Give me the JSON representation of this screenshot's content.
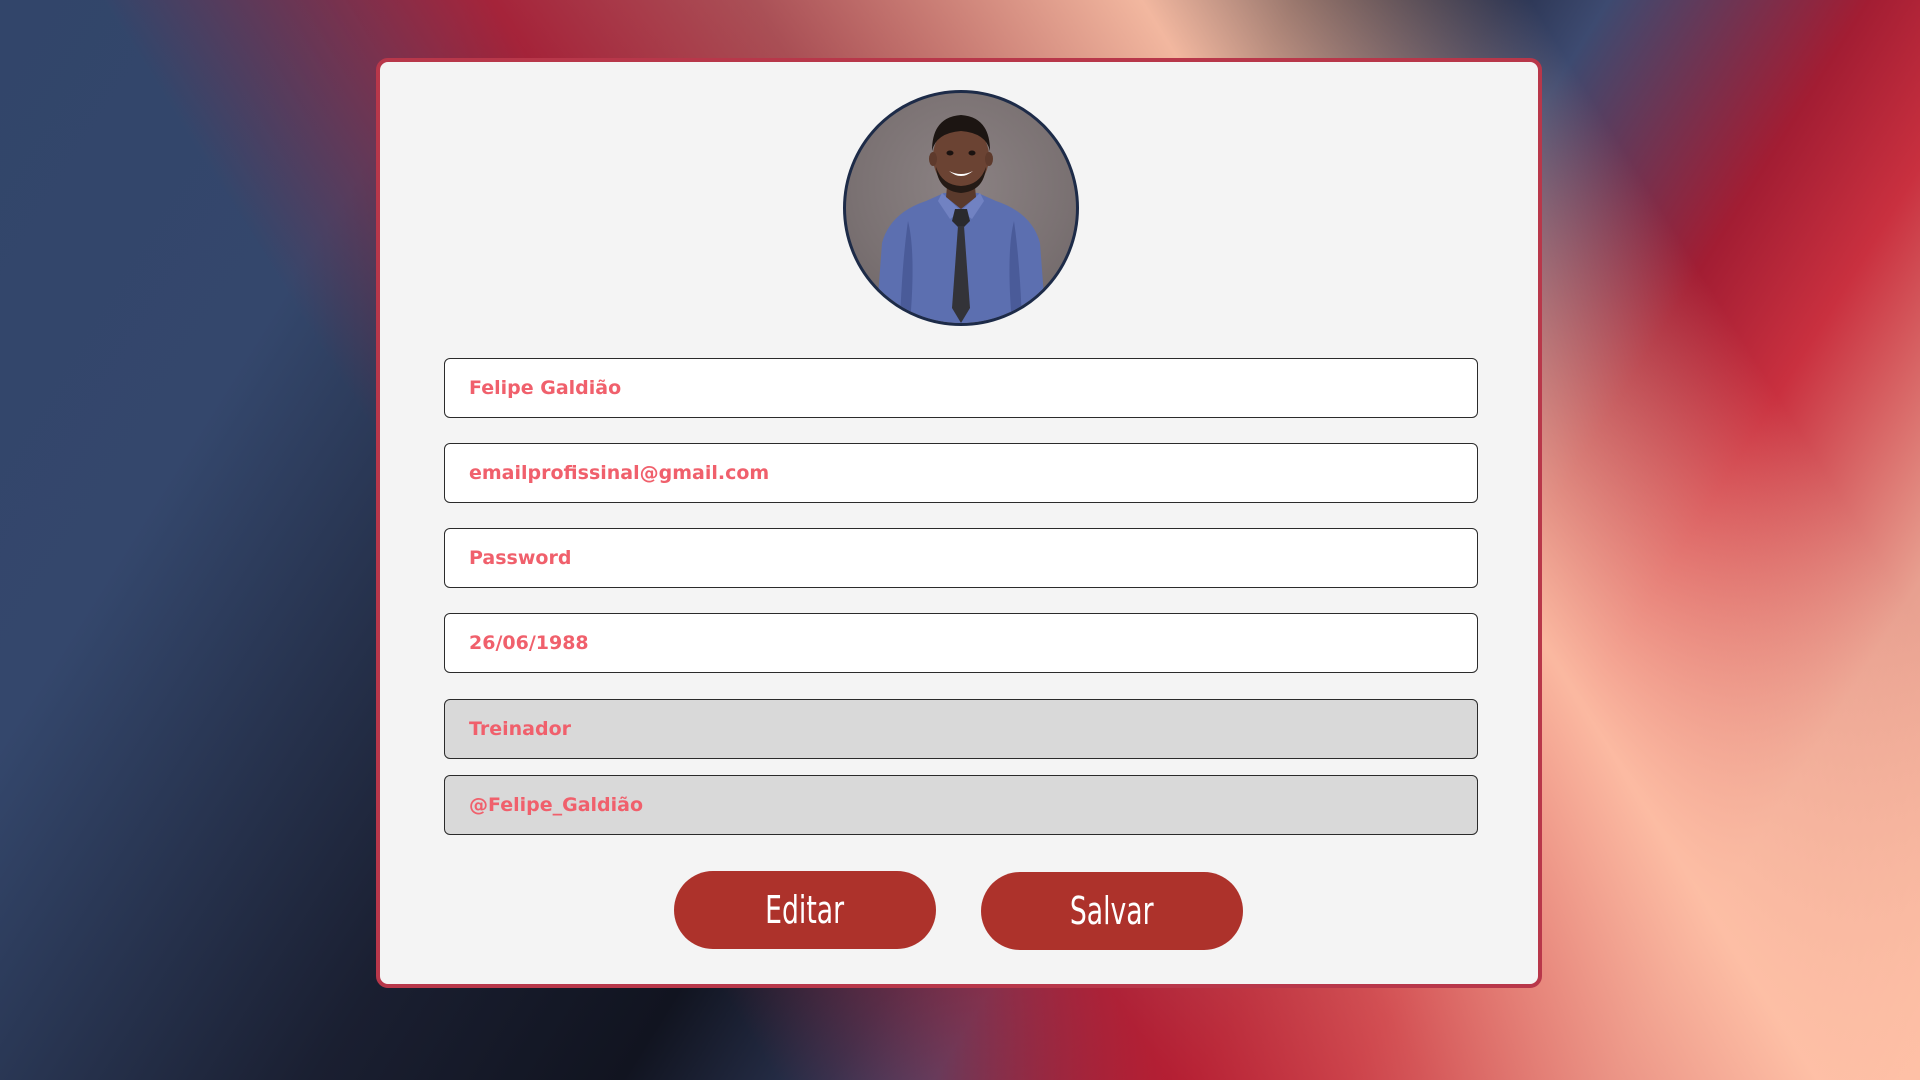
{
  "profile": {
    "avatar_alt": "profile-photo",
    "fields": [
      {
        "name": "name-field",
        "value": "Felipe Galdião",
        "disabled": false
      },
      {
        "name": "email-field",
        "value": "emailprofissinal@gmail.com",
        "disabled": false
      },
      {
        "name": "password-field",
        "value": "Password",
        "disabled": false
      },
      {
        "name": "birthdate-field",
        "value": "26/06/1988",
        "disabled": false
      },
      {
        "name": "role-field",
        "value": "Treinador",
        "disabled": true
      },
      {
        "name": "username-field",
        "value": "@Felipe_Galdião",
        "disabled": true
      }
    ]
  },
  "actions": {
    "edit_label": "Editar",
    "save_label": "Salvar"
  },
  "colors": {
    "accent": "#ad322b",
    "field_text": "#f0606c",
    "card_border": "#b8374a",
    "card_bg": "#f4f4f4",
    "disabled_bg": "#d9d9d9"
  }
}
